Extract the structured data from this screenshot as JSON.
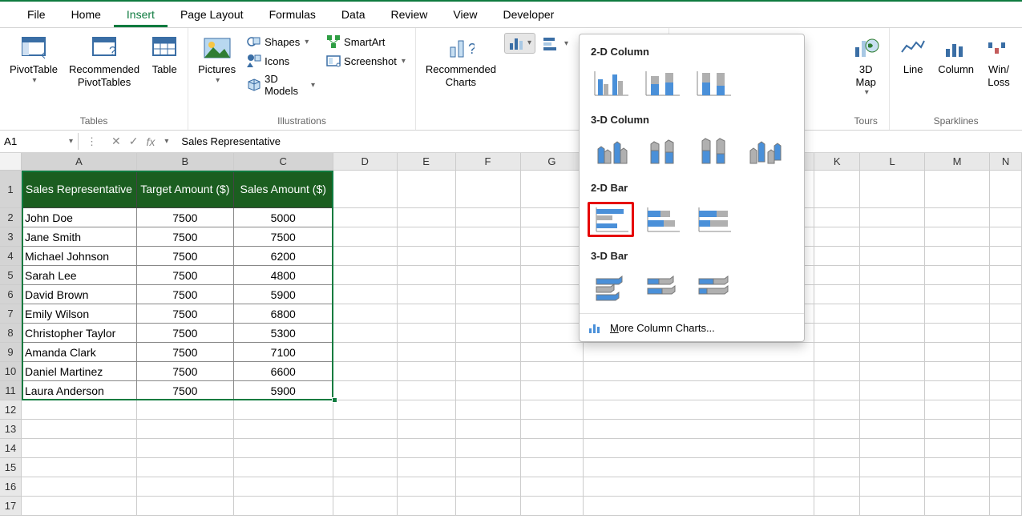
{
  "menu": [
    "File",
    "Home",
    "Insert",
    "Page Layout",
    "Formulas",
    "Data",
    "Review",
    "View",
    "Developer"
  ],
  "menu_active": "Insert",
  "ribbon": {
    "tables": {
      "label": "Tables",
      "pivottable": "PivotTable",
      "recommended": "Recommended PivotTables",
      "table": "Table"
    },
    "illustrations": {
      "label": "Illustrations",
      "pictures": "Pictures",
      "shapes": "Shapes",
      "icons": "Icons",
      "models": "3D Models",
      "smartart": "SmartArt",
      "screenshot": "Screenshot"
    },
    "charts": {
      "label": "",
      "recommended": "Recommended Charts"
    },
    "tours": {
      "label": "Tours",
      "map": "3D Map"
    },
    "sparklines": {
      "label": "Sparklines",
      "line": "Line",
      "column": "Column",
      "winloss": "Win/ Loss"
    }
  },
  "namebox": "A1",
  "formula": "Sales Representative",
  "columns": [
    "A",
    "B",
    "C",
    "D",
    "E",
    "F",
    "G",
    "",
    "",
    "",
    "K",
    "L",
    "M",
    "N"
  ],
  "table": {
    "headers": [
      "Sales Representative",
      "Target Amount ($)",
      "Sales Amount ($)"
    ],
    "rows": [
      [
        "John Doe",
        "7500",
        "5000"
      ],
      [
        "Jane Smith",
        "7500",
        "7500"
      ],
      [
        "Michael Johnson",
        "7500",
        "6200"
      ],
      [
        "Sarah Lee",
        "7500",
        "4800"
      ],
      [
        "David Brown",
        "7500",
        "5900"
      ],
      [
        "Emily Wilson",
        "7500",
        "6800"
      ],
      [
        "Christopher Taylor",
        "7500",
        "5300"
      ],
      [
        "Amanda Clark",
        "7500",
        "7100"
      ],
      [
        "Daniel Martinez",
        "7500",
        "6600"
      ],
      [
        "Laura Anderson",
        "7500",
        "5900"
      ]
    ]
  },
  "dropdown": {
    "sections": [
      "2-D Column",
      "3-D Column",
      "2-D Bar",
      "3-D Bar"
    ],
    "footer_pre": "M",
    "footer": "ore Column Charts..."
  },
  "colors": {
    "accent": "#0e7b3f",
    "tableHeader": "#1b5e20",
    "highlight": "#e60000",
    "chartBlue": "#4a90d9"
  }
}
